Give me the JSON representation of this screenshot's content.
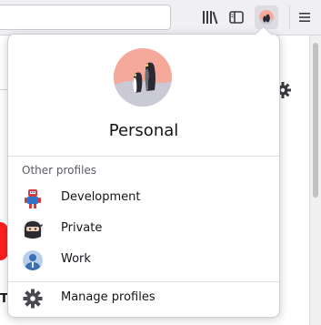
{
  "toolbar": {
    "library_icon": "library-icon",
    "sidebar_icon": "sidebar-icon",
    "profile_icon": "profile-avatar-icon",
    "menu_icon": "hamburger-menu-icon"
  },
  "profiles_panel": {
    "current_profile": {
      "name": "Personal",
      "avatar": "penguin-avatar"
    },
    "other_profiles_heading": "Other profiles",
    "other_profiles": [
      {
        "label": "Development",
        "icon": "robot-avatar-icon"
      },
      {
        "label": "Private",
        "icon": "ninja-avatar-icon"
      },
      {
        "label": "Work",
        "icon": "person-avatar-icon"
      }
    ],
    "manage_label": "Manage profiles",
    "manage_icon": "gear-icon"
  },
  "page": {
    "peek_text": "T"
  },
  "colors": {
    "accent_red": "#ff1f1f",
    "avatar_bg_pink": "#f4a99a",
    "avatar_bg_gray": "#c9cad6"
  }
}
